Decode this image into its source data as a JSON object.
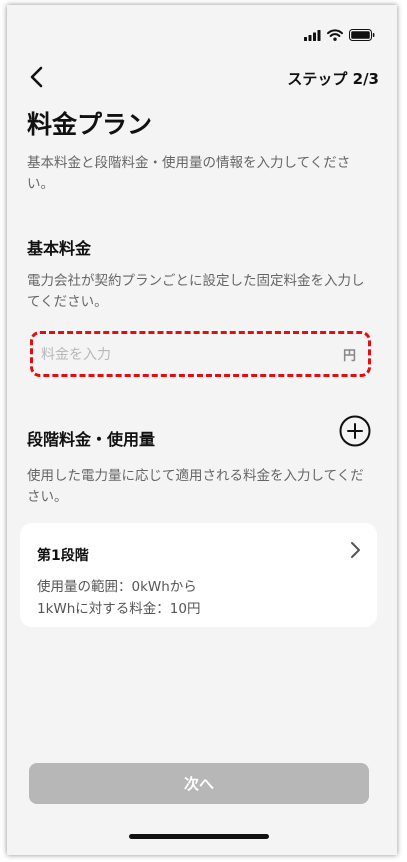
{
  "header": {
    "back_icon": "chevron-left-icon",
    "step_label": "ステップ 2/3"
  },
  "status_bar": {
    "icons": [
      "signal-icon",
      "wifi-icon",
      "battery-icon"
    ]
  },
  "page": {
    "title": "料金プラン",
    "description": "基本料金と段階料金・使用量の情報を入力してください。"
  },
  "basic_fee": {
    "title": "基本料金",
    "description": "電力会社が契約プランごとに設定した固定料金を入力してください。",
    "input": {
      "value": "",
      "placeholder": "料金を入力",
      "unit": "円"
    }
  },
  "tiered": {
    "title": "段階料金・使用量",
    "add_icon": "plus-circle-icon",
    "description": "使用した電力量に応じて適用される料金を入力してください。",
    "tiers": [
      {
        "name": "第1段階",
        "range": "使用量の範囲：0kWhから",
        "rate": "1kWhに対する料金：10円"
      }
    ]
  },
  "footer": {
    "next_label": "次へ"
  },
  "colors": {
    "background": "#f4f4f4",
    "highlight_border": "#e01010",
    "disabled_button": "#b7b7b7",
    "card": "#ffffff"
  }
}
